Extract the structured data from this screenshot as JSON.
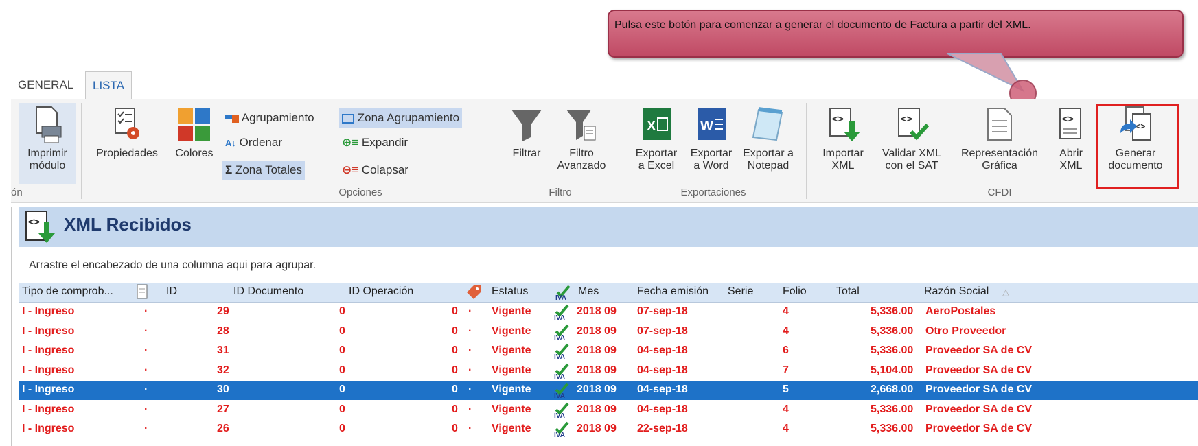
{
  "callout": {
    "text": "Pulsa este botón para comenzar a generar el documento de Factura a partir del XML."
  },
  "tabs": [
    {
      "label": "GENERAL"
    },
    {
      "label": "LISTA"
    }
  ],
  "ribbon": {
    "print": {
      "label": "Imprimir\nmódulo",
      "group_fragment": "ón"
    },
    "opciones": {
      "propiedades": "Propiedades",
      "colores": "Colores",
      "agrupamiento": "Agrupamiento",
      "ordenar": "Ordenar",
      "zona_totales": "Zona Totales",
      "zona_agrupamiento": "Zona Agrupamiento",
      "expandir": "Expandir",
      "colapsar": "Colapsar",
      "group": "Opciones"
    },
    "filtro": {
      "filtrar": "Filtrar",
      "avanzado": "Filtro\nAvanzado",
      "group": "Filtro"
    },
    "exportaciones": {
      "excel": "Exportar\na Excel",
      "word": "Exportar\na Word",
      "notepad": "Exportar a\nNotepad",
      "group": "Exportaciones"
    },
    "cfdi": {
      "importar": "Importar\nXML",
      "validar": "Validar XML\ncon el SAT",
      "representacion": "Representación\nGráfica",
      "abrir": "Abrir\nXML",
      "generar": "Generar\ndocumento",
      "group": "CFDI"
    }
  },
  "module": {
    "title": "XML Recibidos",
    "group_hint": "Arrastre el encabezado de una columna aqui para agrupar."
  },
  "columns": [
    "Tipo de comprob...",
    "ID",
    "ID Documento",
    "ID Operación",
    "Estatus",
    "Mes",
    "Fecha emisión",
    "Serie",
    "Folio",
    "Total",
    "Razón Social"
  ],
  "rows": [
    {
      "tipo": "I - Ingreso",
      "dot": "·",
      "id": "29",
      "iddoc": "0",
      "idop": "0",
      "dot2": "·",
      "estatus": "Vigente",
      "mes": "2018 09",
      "fecha": "07-sep-18",
      "folio": "4",
      "total": "5,336.00",
      "razon": "AeroPostales"
    },
    {
      "tipo": "I - Ingreso",
      "dot": "·",
      "id": "28",
      "iddoc": "0",
      "idop": "0",
      "dot2": "·",
      "estatus": "Vigente",
      "mes": "2018 09",
      "fecha": "07-sep-18",
      "folio": "4",
      "total": "5,336.00",
      "razon": "Otro Proveedor"
    },
    {
      "tipo": "I - Ingreso",
      "dot": "·",
      "id": "31",
      "iddoc": "0",
      "idop": "0",
      "dot2": "·",
      "estatus": "Vigente",
      "mes": "2018 09",
      "fecha": "04-sep-18",
      "folio": "6",
      "total": "5,336.00",
      "razon": "Proveedor SA de CV"
    },
    {
      "tipo": "I - Ingreso",
      "dot": "·",
      "id": "32",
      "iddoc": "0",
      "idop": "0",
      "dot2": "·",
      "estatus": "Vigente",
      "mes": "2018 09",
      "fecha": "04-sep-18",
      "folio": "7",
      "total": "5,104.00",
      "razon": "Proveedor SA de CV"
    },
    {
      "tipo": "I - Ingreso",
      "dot": "·",
      "id": "30",
      "iddoc": "0",
      "idop": "0",
      "dot2": "·",
      "estatus": "Vigente",
      "mes": "2018 09",
      "fecha": "04-sep-18",
      "folio": "5",
      "total": "2,668.00",
      "razon": "Proveedor SA de CV"
    },
    {
      "tipo": "I - Ingreso",
      "dot": "·",
      "id": "27",
      "iddoc": "0",
      "idop": "0",
      "dot2": "·",
      "estatus": "Vigente",
      "mes": "2018 09",
      "fecha": "04-sep-18",
      "folio": "4",
      "total": "5,336.00",
      "razon": "Proveedor SA de CV"
    },
    {
      "tipo": "I - Ingreso",
      "dot": "·",
      "id": "26",
      "iddoc": "0",
      "idop": "0",
      "dot2": "·",
      "estatus": "Vigente",
      "mes": "2018 09",
      "fecha": "22-sep-18",
      "folio": "4",
      "total": "5,336.00",
      "razon": "Proveedor SA de CV"
    }
  ],
  "selected_row_index": 4,
  "colors": {
    "accent": "#2b68b1",
    "row_text": "#e21c1c",
    "selected_row": "#1e72c8",
    "callout": "#c04a64",
    "highlight": "#e02020"
  },
  "icons": [
    "printer-icon",
    "properties-icon",
    "colors-icon",
    "group-icon",
    "sort-az-icon",
    "sum-icon",
    "group-zone-icon",
    "expand-icon",
    "collapse-icon",
    "filter-icon",
    "advanced-filter-icon",
    "excel-icon",
    "word-icon",
    "notepad-icon",
    "import-xml-icon",
    "validate-xml-icon",
    "graphic-representation-icon",
    "open-xml-icon",
    "generate-document-icon",
    "xml-module-icon",
    "clip-icon",
    "tag-icon",
    "iva-icon",
    "sort-up-icon"
  ]
}
